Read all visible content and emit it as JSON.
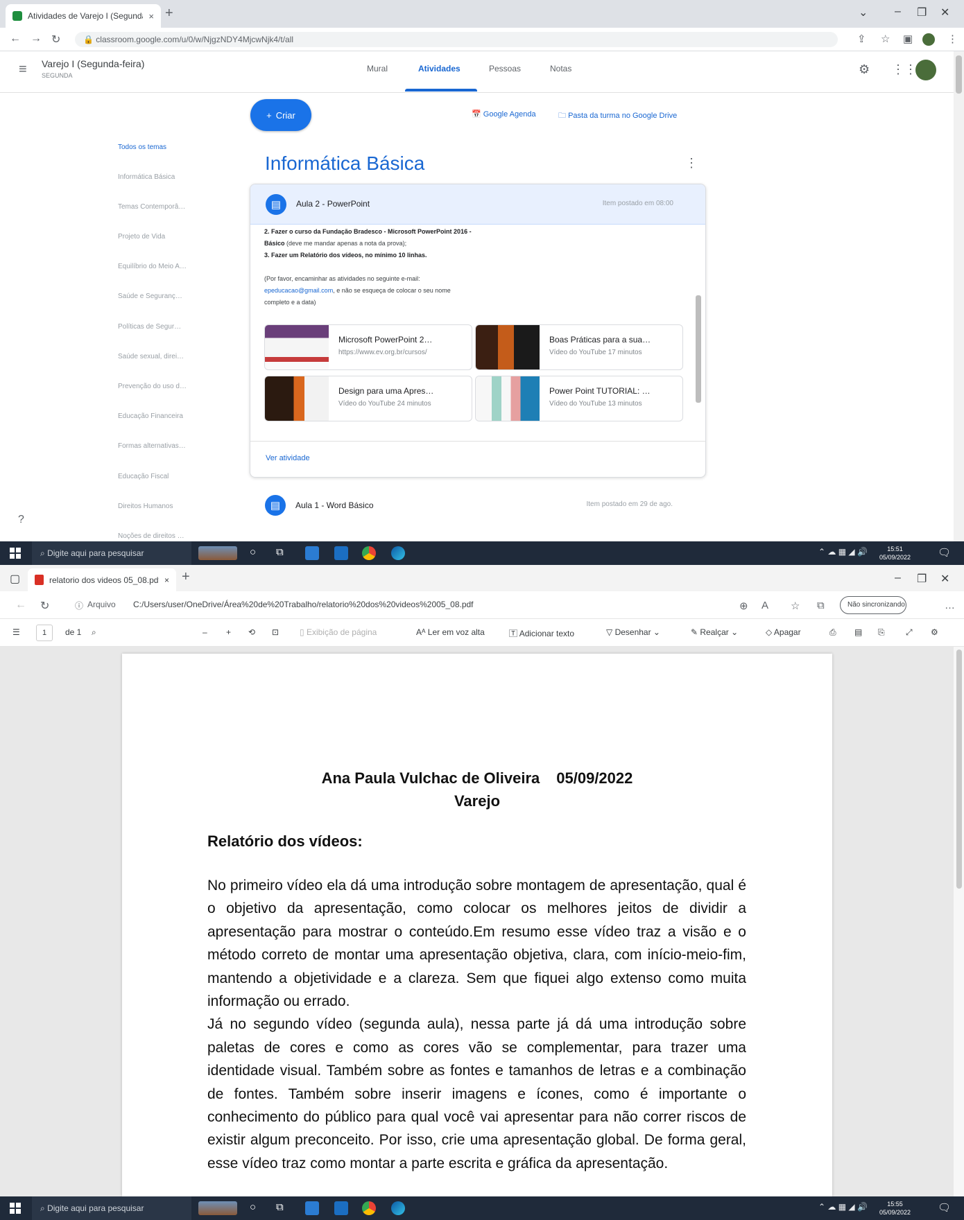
{
  "classroom": {
    "browser": {
      "tab_title": "Atividades de Varejo I (Segunda …",
      "url": "classroom.google.com/u/0/w/NjgzNDY4MjcwNjk4/t/all",
      "close": "×",
      "new_tab": "+"
    },
    "header": {
      "class_name": "Varejo I (Segunda-feira)",
      "class_sub": "SEGUNDA",
      "tabs": [
        "Mural",
        "Atividades",
        "Pessoas",
        "Notas"
      ],
      "active_tab": "Atividades"
    },
    "create_label": "Criar",
    "links": {
      "calendar": "Google Agenda",
      "drive": "Pasta da turma no Google Drive"
    },
    "sidebar": [
      "Todos os temas",
      "Informática Básica",
      "Temas Contemporâ…",
      "Projeto de Vida",
      "Equilíbrio do Meio A…",
      "Saúde e Seguranç…",
      "Políticas de Segur…",
      "Saúde sexual, direi…",
      "Prevenção do uso d…",
      "Educação Financeira",
      "Formas alternativas…",
      "Educação Fiscal",
      "Direitos Humanos",
      "Noções de direitos …"
    ],
    "topic_title": "Informática Básica",
    "assignment": {
      "title": "Aula 2 - PowerPoint",
      "meta": "Item postado em 08:00",
      "lines": [
        {
          "b": "2. Fazer o curso da Fundação Bradesco - Microsoft PowerPoint 2016 -",
          "t": ""
        },
        {
          "b": "Básico",
          "t": " (deve me mandar apenas a nota da prova);"
        },
        {
          "b": "3. Fazer um Relatório dos vídeos, no mínimo 10 linhas.",
          "t": ""
        }
      ],
      "note_line1": "(Por favor, encaminhar as atividades no seguinte e-mail:",
      "email": "epeducacao@gmail.com",
      "note_line2_rest": ", e não se esqueça de colocar o seu nome",
      "note_line3": "completo e a data)",
      "attachments": [
        {
          "title": "Microsoft PowerPoint 2…",
          "sub": "https://www.ev.org.br/cursos/"
        },
        {
          "title": "Boas Práticas para a sua…",
          "sub": "Vídeo do YouTube   17 minutos"
        },
        {
          "title": "Design para uma Apres…",
          "sub": "Vídeo do YouTube   24 minutos"
        },
        {
          "title": "Power Point TUTORIAL: …",
          "sub": "Vídeo do YouTube   13 minutos"
        }
      ],
      "see_activity": "Ver atividade"
    },
    "next_item": {
      "title": "Aula 1 - Word Básico",
      "meta": "Item postado em 29 de ago."
    }
  },
  "taskbar": {
    "search": "Digite aqui para pesquisar",
    "time1": "15:51",
    "date1": "05/09/2022",
    "time2": "15:55",
    "date2": "05/09/2022"
  },
  "edge": {
    "tab_title": "relatorio dos videos 05_08.pdf",
    "close": "×",
    "new_tab": "+",
    "url_prefix": "Arquivo",
    "url": "C:/Users/user/OneDrive/Área%20de%20Trabalho/relatorio%20dos%20videos%2005_08.pdf",
    "sync": "Não sincronizando",
    "page_current": "1",
    "page_total": "de 1",
    "toolbar": {
      "page_view": "Exibição de página",
      "read_aloud": "Ler em voz alta",
      "add_text": "Adicionar texto",
      "draw": "Desenhar",
      "highlight": "Realçar",
      "erase": "Apagar"
    }
  },
  "document": {
    "name": "Ana Paula Vulchac de Oliveira",
    "date": "05/09/2022",
    "course": "Varejo",
    "heading": "Relatório dos vídeos:",
    "paragraphs": [
      "No primeiro vídeo ela dá uma introdução sobre montagem de apresentação, qual é o objetivo da apresentação, como colocar os melhores jeitos de dividir a apresentação para mostrar o conteúdo.Em resumo esse vídeo traz a visão e o método correto de montar uma apresentação objetiva, clara, com início-meio-fim, mantendo a objetividade e a clareza. Sem que fiquei algo extenso como muita informação ou errado.",
      "Já no segundo vídeo (segunda aula), nessa parte já dá uma introdução sobre paletas de cores e como as cores vão se complementar, para trazer uma identidade visual. Também sobre as fontes e tamanhos de letras e a combinação de fontes. Também sobre inserir imagens e ícones, como é importante o conhecimento do público para qual você vai apresentar para não correr riscos de existir algum preconceito. Por isso, crie uma apresentação global.  De forma geral, esse vídeo traz como montar a parte escrita e gráfica da apresentação."
    ]
  },
  "colors": {
    "classroom_blue": "#1967d2",
    "taskbar": "#1f2a3a",
    "pdf_red": "#d93025"
  }
}
